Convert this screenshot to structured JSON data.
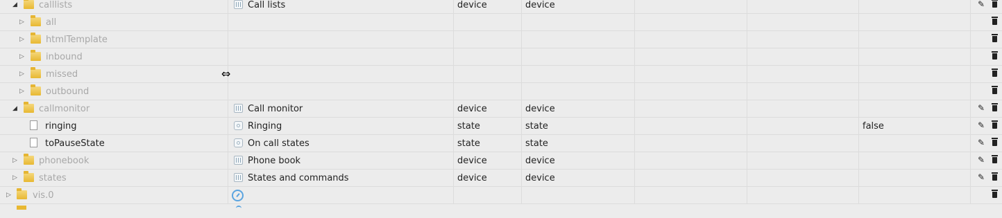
{
  "rows": [
    {
      "level": 1,
      "expanded": true,
      "node": "folder",
      "id": "calllists",
      "muted": true,
      "name_icon": "channel",
      "name": "Call lists",
      "type": "device",
      "role": "device",
      "value": "",
      "actions": [
        "edit",
        "delete"
      ]
    },
    {
      "level": 2,
      "expanded": false,
      "node": "folder",
      "id": "all",
      "muted": true,
      "name_icon": "",
      "name": "",
      "type": "",
      "role": "",
      "value": "",
      "actions": [
        "delete"
      ]
    },
    {
      "level": 2,
      "expanded": false,
      "node": "folder",
      "id": "htmlTemplate",
      "muted": true,
      "name_icon": "",
      "name": "",
      "type": "",
      "role": "",
      "value": "",
      "actions": [
        "delete"
      ]
    },
    {
      "level": 2,
      "expanded": false,
      "node": "folder",
      "id": "inbound",
      "muted": true,
      "name_icon": "",
      "name": "",
      "type": "",
      "role": "",
      "value": "",
      "actions": [
        "delete"
      ]
    },
    {
      "level": 2,
      "expanded": false,
      "node": "folder",
      "id": "missed",
      "muted": true,
      "name_icon": "",
      "name": "",
      "type": "",
      "role": "",
      "value": "",
      "actions": [
        "delete"
      ]
    },
    {
      "level": 2,
      "expanded": false,
      "node": "folder",
      "id": "outbound",
      "muted": true,
      "name_icon": "",
      "name": "",
      "type": "",
      "role": "",
      "value": "",
      "actions": [
        "delete"
      ]
    },
    {
      "level": 1,
      "expanded": true,
      "node": "folder",
      "id": "callmonitor",
      "muted": true,
      "name_icon": "channel",
      "name": "Call monitor",
      "type": "device",
      "role": "device",
      "value": "",
      "actions": [
        "edit",
        "delete"
      ]
    },
    {
      "level": 2,
      "expanded": null,
      "node": "file",
      "id": "ringing",
      "muted": false,
      "name_icon": "state",
      "name": "Ringing",
      "type": "state",
      "role": "state",
      "value": "false",
      "actions": [
        "edit",
        "delete"
      ]
    },
    {
      "level": 2,
      "expanded": null,
      "node": "file",
      "id": "toPauseState",
      "muted": false,
      "name_icon": "state",
      "name": "On call states",
      "type": "state",
      "role": "state",
      "value": "",
      "actions": [
        "edit",
        "delete"
      ]
    },
    {
      "level": 1,
      "expanded": false,
      "node": "folder",
      "id": "phonebook",
      "muted": true,
      "name_icon": "channel",
      "name": "Phone book",
      "type": "device",
      "role": "device",
      "value": "",
      "actions": [
        "edit",
        "delete"
      ]
    },
    {
      "level": 1,
      "expanded": false,
      "node": "folder",
      "id": "states",
      "muted": true,
      "name_icon": "channel",
      "name": "States and commands",
      "type": "device",
      "role": "device",
      "value": "",
      "actions": [
        "edit",
        "delete"
      ]
    },
    {
      "level": 0,
      "expanded": false,
      "node": "folder",
      "id": "vis.0",
      "muted": true,
      "name_icon": "gauge",
      "name": "",
      "type": "",
      "role": "",
      "value": "",
      "actions": [
        "delete"
      ]
    }
  ],
  "icons": {
    "collapsed_arrow": "▷",
    "expanded_arrow": "◢",
    "edit": "✎",
    "resize_cursor": "⇔"
  }
}
